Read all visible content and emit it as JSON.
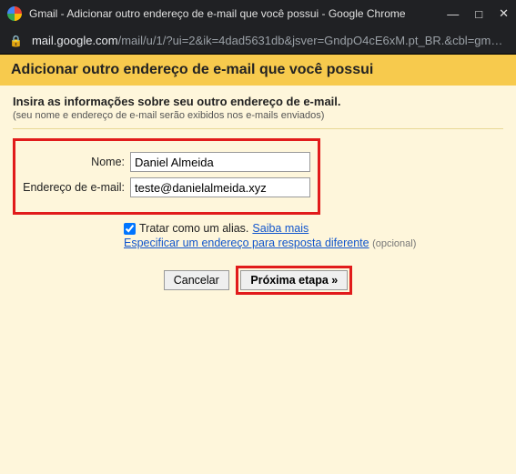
{
  "window": {
    "title": "Gmail - Adicionar outro endereço de e-mail que você possui - Google Chrome",
    "minimize": "—",
    "maximize": "□",
    "close": "✕"
  },
  "address": {
    "host": "mail.google.com",
    "path": "/mail/u/1/?ui=2&ik=4dad5631db&jsver=GndpO4cE6xM.pt_BR.&cbl=gma..."
  },
  "header": {
    "title": "Adicionar outro endereço de e-mail que você possui"
  },
  "instructions": {
    "main": "Insira as informações sobre seu outro endereço de e-mail.",
    "sub": "(seu nome e endereço de e-mail serão exibidos nos e-mails enviados)"
  },
  "form": {
    "name_label": "Nome:",
    "name_value": "Daniel Almeida",
    "email_label": "Endereço de e-mail:",
    "email_value": "teste@danielalmeida.xyz",
    "alias_label": "Tratar como um alias.",
    "alias_learn": "Saiba mais",
    "reply_link": "Especificar um endereço para resposta diferente",
    "optional": "(opcional)"
  },
  "buttons": {
    "cancel": "Cancelar",
    "next": "Próxima etapa »"
  }
}
